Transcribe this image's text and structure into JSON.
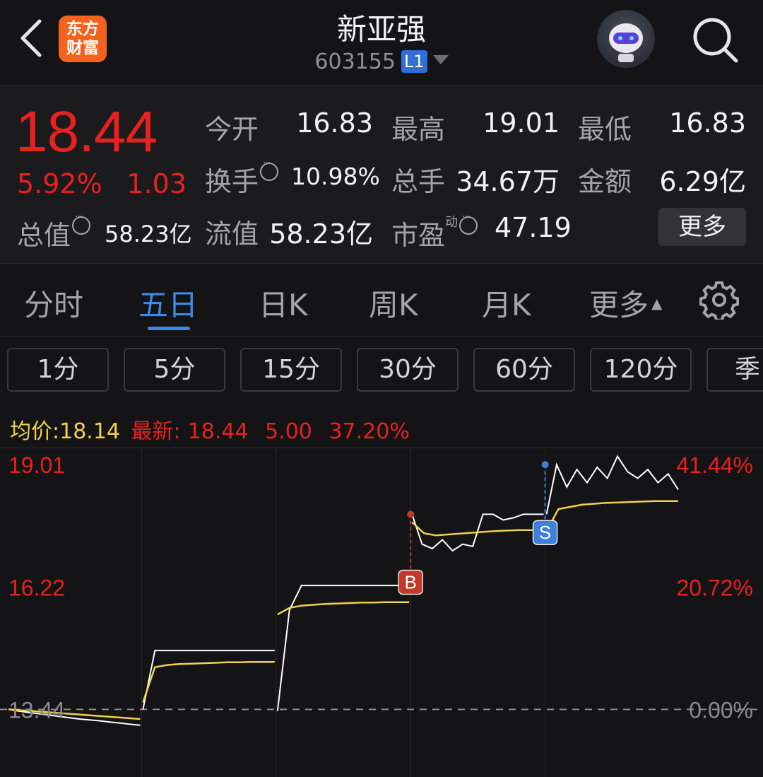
{
  "header": {
    "logo_line1": "东方",
    "logo_line2": "财富",
    "stock_name": "新亚强",
    "stock_code": "603155",
    "level_badge": "L1",
    "back_icon": "chevron-left-icon",
    "search_icon": "search-icon",
    "avatar_icon": "robot-avatar-icon"
  },
  "quote": {
    "price": "18.44",
    "change_pct": "5.92%",
    "change_amt": "1.03",
    "open_label": "今开",
    "open_value": "16.83",
    "high_label": "最高",
    "high_value": "19.01",
    "low_label": "最低",
    "low_value": "16.83",
    "turnover_label": "换手",
    "turnover_value": "10.98%",
    "volume_label": "总手",
    "volume_value": "34.67万",
    "amount_label": "金额",
    "amount_value": "6.29亿",
    "total_cap_label": "总值",
    "total_cap_value": "58.23亿",
    "float_cap_label": "流值",
    "float_cap_value": "58.23亿",
    "pe_label": "市盈",
    "pe_sup": "动",
    "pe_value": "47.19",
    "more_label": "更多"
  },
  "tabs": [
    "分时",
    "五日",
    "日K",
    "周K",
    "月K",
    "更多"
  ],
  "active_tab": "五日",
  "settings_icon": "gear-icon",
  "periods": [
    "1分",
    "5分",
    "15分",
    "30分",
    "60分",
    "120分",
    "季"
  ],
  "info_line": {
    "avg_label": "均价:",
    "avg_value": "18.14",
    "latest_label": "最新:",
    "latest_value": "18.44",
    "latest_change": "5.00",
    "latest_pct": "37.20%"
  },
  "chart_data": {
    "type": "line",
    "y_left_labels": [
      "19.01",
      "16.22",
      "13.44"
    ],
    "y_right_labels": [
      "41.44%",
      "20.72%",
      "0.00%"
    ],
    "ylim": [
      11.9,
      19.4
    ],
    "baseline": 13.44,
    "days": 5,
    "series": [
      {
        "name": "price",
        "color": "#ffffff",
        "days": [
          [
            13.44,
            13.4,
            13.37,
            13.34,
            13.31,
            13.28,
            13.25,
            13.22,
            13.2,
            13.18,
            13.15,
            13.13,
            13.1,
            13.08
          ],
          [
            13.44,
            14.78,
            14.78,
            14.78,
            14.78,
            14.78,
            14.78,
            14.78,
            14.78,
            14.78,
            14.78,
            14.78
          ],
          [
            13.4,
            15.7,
            16.26,
            16.26,
            16.26,
            16.26,
            16.26,
            16.26,
            16.26,
            16.26,
            16.26,
            16.26
          ],
          [
            17.88,
            17.2,
            17.1,
            17.3,
            17.05,
            17.2,
            17.15,
            17.88,
            17.88,
            17.75,
            17.8,
            17.88,
            17.88,
            17.88
          ],
          [
            17.88,
            19.01,
            18.5,
            18.9,
            18.6,
            18.95,
            18.7,
            19.2,
            18.85,
            18.7,
            18.9,
            18.6,
            18.8,
            18.44
          ]
        ]
      },
      {
        "name": "avg",
        "color": "#f0d24a",
        "days": [
          [
            13.44,
            13.42,
            13.4,
            13.38,
            13.36,
            13.34,
            13.32,
            13.3,
            13.28,
            13.26,
            13.24,
            13.22
          ],
          [
            13.6,
            14.4,
            14.45,
            14.47,
            14.48,
            14.49,
            14.5,
            14.51,
            14.51,
            14.52,
            14.52,
            14.52
          ],
          [
            15.6,
            15.75,
            15.8,
            15.82,
            15.84,
            15.85,
            15.86,
            15.87,
            15.87,
            15.88,
            15.88,
            15.88
          ],
          [
            17.7,
            17.45,
            17.4,
            17.42,
            17.44,
            17.46,
            17.48,
            17.5,
            17.51,
            17.52,
            17.52,
            17.53
          ],
          [
            17.5,
            18.0,
            18.05,
            18.1,
            18.12,
            18.14,
            18.15,
            18.16,
            18.17,
            18.18,
            18.18,
            18.18
          ]
        ]
      }
    ],
    "markers": [
      {
        "label": "B",
        "day": 3,
        "price": 17.88,
        "color": "#c0392b"
      },
      {
        "label": "S",
        "day": 4,
        "price": 19.01,
        "color": "#3d7fd9"
      }
    ]
  }
}
